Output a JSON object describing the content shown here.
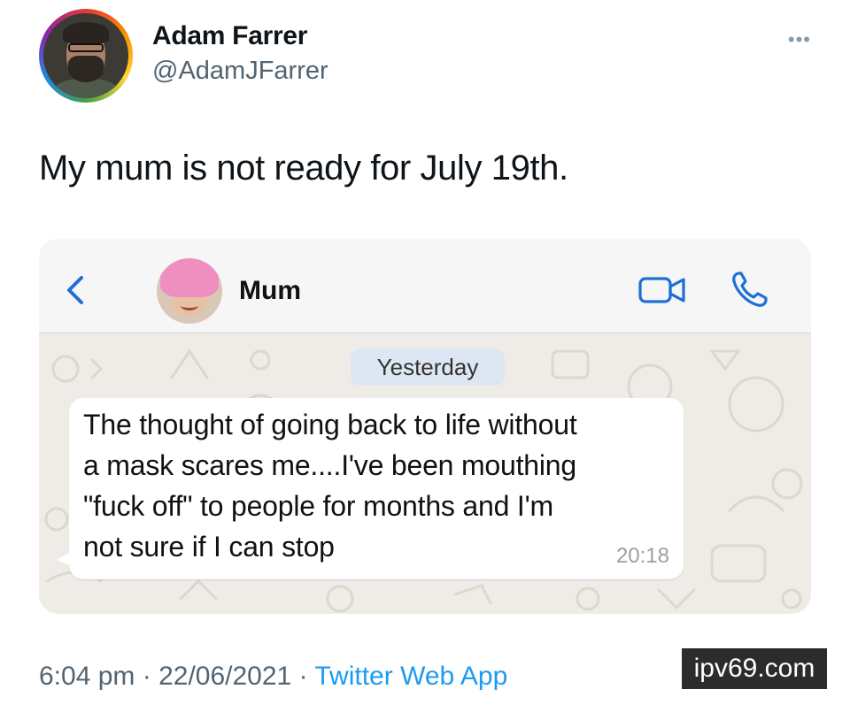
{
  "tweet": {
    "display_name": "Adam Farrer",
    "handle": "@AdamJFarrer",
    "more_icon": "more-icon",
    "text": "My mum is not ready for July 19th.",
    "timestamp": "6:04 pm",
    "date": "22/06/2021",
    "separator": "·",
    "source": "Twitter Web App"
  },
  "chat": {
    "contact_name": "Mum",
    "icons": [
      "back-icon",
      "video-call-icon",
      "phone-call-icon"
    ],
    "date_label": "Yesterday",
    "message": {
      "lines": [
        "The thought of going back to life without",
        "a mask scares me....I've been mouthing",
        "\"fuck off\" to people for months and I'm",
        "not sure if I can stop"
      ],
      "time": "20:18"
    },
    "accent_color": "#1d6fd8"
  },
  "watermark": "ipv69.com",
  "colors": {
    "link": "#1d9bf0",
    "muted": "#536471",
    "date_pill": "#dde7f3"
  }
}
